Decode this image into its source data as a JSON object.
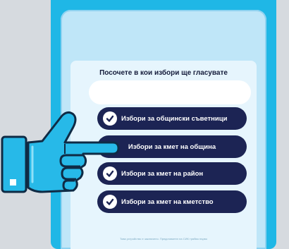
{
  "screen": {
    "question": "Посочете в кои избори ще гласувате",
    "options": [
      {
        "label": "Избори за общински съветници",
        "checked": true
      },
      {
        "label": "Избори за кмет на община",
        "checked": false
      },
      {
        "label": "Избори за кмет на район",
        "checked": true
      },
      {
        "label": "Избори за кмет на кметство",
        "checked": true
      }
    ],
    "footnote": "Това устройство е заключено. Представител на СИК трябва първо"
  },
  "colors": {
    "device": "#1fb7e6",
    "screen_bg": "#e6f5fd",
    "option_bg": "#1c2454",
    "option_text": "#ffffff",
    "hand": "#27b9e8"
  },
  "icons": {
    "check": "check-circle-icon",
    "hand": "pointing-hand-icon"
  }
}
